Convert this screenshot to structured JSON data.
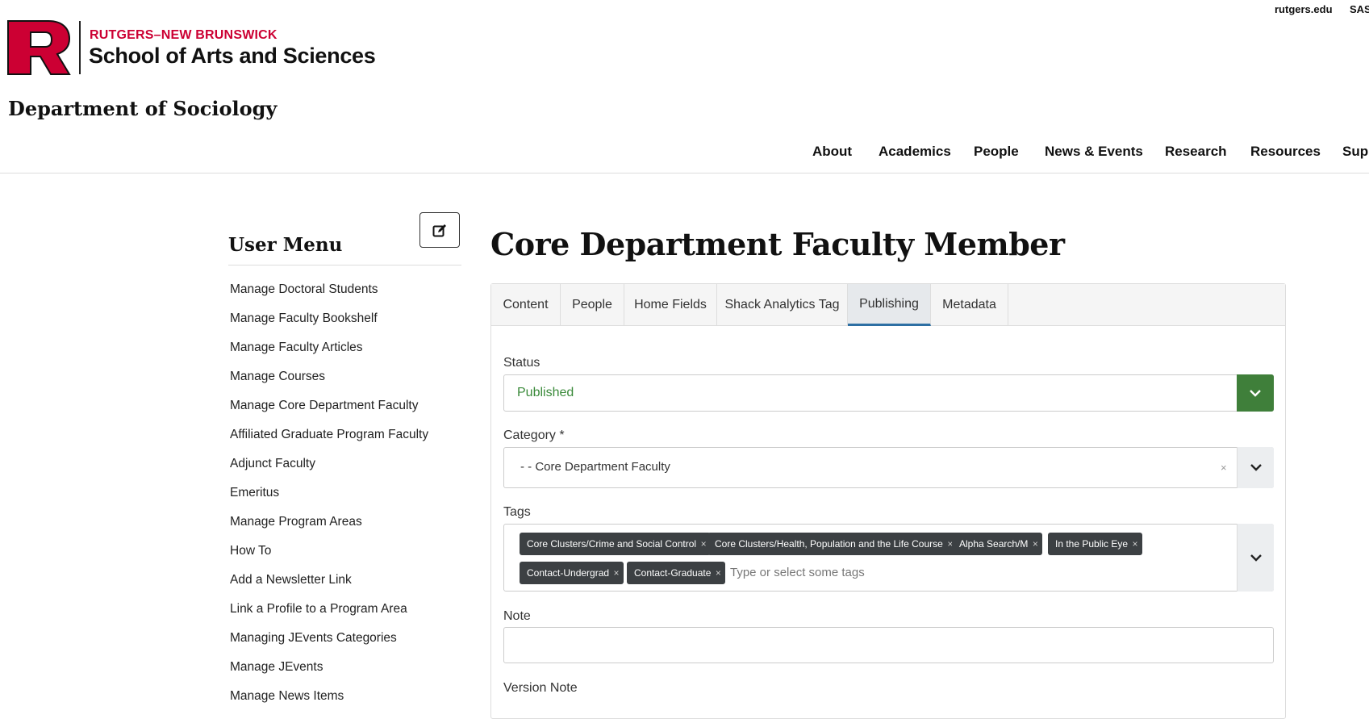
{
  "utility_links": [
    "rutgers.edu",
    "SAS"
  ],
  "brand": {
    "top_line": "RUTGERS–NEW BRUNSWICK",
    "bottom_line": "School of Arts and Sciences",
    "logo_letter": "R",
    "red": "#cc0033"
  },
  "department": "Department of Sociology",
  "main_nav": [
    "About",
    "Academics",
    "People",
    "News & Events",
    "Research",
    "Resources",
    "Supp"
  ],
  "sidebar": {
    "title": "User Menu",
    "edit_icon": "edit-icon",
    "items": [
      "Manage Doctoral Students",
      "Manage Faculty Bookshelf",
      "Manage Faculty Articles",
      "Manage Courses",
      "Manage Core Department Faculty",
      "Affiliated Graduate Program Faculty",
      "Adjunct Faculty",
      "Emeritus",
      "Manage Program Areas",
      "How To",
      "Add a Newsletter Link",
      "Link a Profile to a Program Area",
      "Managing JEvents Categories",
      "Manage JEvents",
      "Manage News Items"
    ]
  },
  "page_title": "Core Department Faculty Member",
  "tabs": [
    {
      "label": "Content",
      "active": false
    },
    {
      "label": "People",
      "active": false
    },
    {
      "label": "Home Fields",
      "active": false
    },
    {
      "label": "Shack Analytics Tag",
      "active": false
    },
    {
      "label": "Publishing",
      "active": true
    },
    {
      "label": "Metadata",
      "active": false
    }
  ],
  "form": {
    "status": {
      "label": "Status",
      "value": "Published",
      "color": "#3a8a3a",
      "caret_bg": "#3f7f3a"
    },
    "category": {
      "label": "Category *",
      "value": "- - Core Department Faculty",
      "clear": "×"
    },
    "tags": {
      "label": "Tags",
      "items": [
        "Core Clusters/Crime and Social Control",
        "Core Clusters/Health, Population and the Life Course",
        "Alpha Search/M",
        "In the Public Eye",
        "Contact-Undergrad",
        "Contact-Graduate"
      ],
      "remove": "×",
      "placeholder": "Type or select some tags"
    },
    "note": {
      "label": "Note",
      "value": ""
    },
    "version_note": {
      "label": "Version Note"
    }
  },
  "accent": "#2d6fa3"
}
